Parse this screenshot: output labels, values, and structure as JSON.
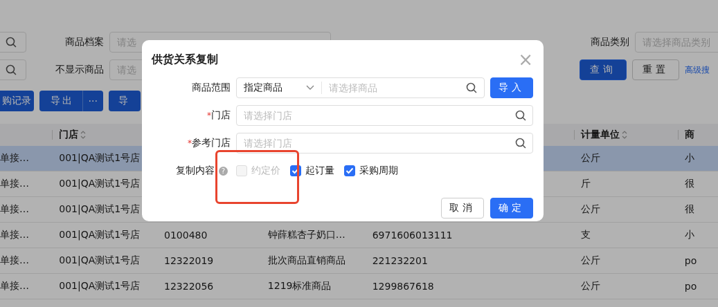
{
  "filters": {
    "row_1": {
      "label": "商品档案",
      "placeholder": "请选",
      "right_label": "商品类别",
      "right_placeholder": "请选择商品类别"
    },
    "row_2": {
      "label": "不显示商品",
      "placeholder": "请选",
      "query_button": "查询",
      "reset_button": "重置",
      "advanced_link": "高级搜"
    }
  },
  "toolbar": {
    "buttons": [
      {
        "label": "购记录",
        "more": false
      },
      {
        "label": "导出",
        "more": true,
        "more_label": "···"
      },
      {
        "label": "导",
        "more": false
      }
    ]
  },
  "table": {
    "columns": [
      {},
      {
        "label": "门店",
        "sortable": true
      },
      {},
      {},
      {},
      {
        "label": "计量单位",
        "sortable": true
      },
      {
        "label": "商",
        "sortable": false
      }
    ],
    "rows": [
      {
        "selected": true,
        "cells": [
          "单接…",
          "001|QA测试1号店",
          null,
          null,
          null,
          "公斤",
          "小"
        ]
      },
      {
        "selected": false,
        "cells": [
          "单接…",
          "001|QA测试1号店",
          null,
          null,
          null,
          "斤",
          "很"
        ]
      },
      {
        "selected": false,
        "cells": [
          "单接…",
          "001|QA测试1号店",
          null,
          null,
          null,
          "公斤",
          "很"
        ]
      },
      {
        "selected": false,
        "cells": [
          "单接…",
          "001|QA测试1号店",
          "0100480",
          "钟薛糕杏子奶口…",
          "6971606013111",
          "支",
          "小"
        ]
      },
      {
        "selected": false,
        "cells": [
          "单接…",
          "001|QA测试1号店",
          "12322019",
          "批次商品直销商品",
          "221232201",
          "公斤",
          "po"
        ]
      },
      {
        "selected": false,
        "cells": [
          "单接…",
          "001|QA测试1号店",
          "12322056",
          "1219标准商品",
          "1299867618",
          "公斤",
          "po"
        ]
      }
    ]
  },
  "dialog": {
    "title": "供货关系复制",
    "close": "×",
    "scope": {
      "label": "商品范围",
      "select_value": "指定商品",
      "placeholder": "请选择商品",
      "import_button": "导入"
    },
    "store": {
      "label": "门店",
      "required_mark": "*",
      "placeholder": "请选择门店"
    },
    "reference_store": {
      "label": "参考门店",
      "required_mark": "*",
      "placeholder": "请选择门店"
    },
    "copy_content": {
      "label": "复制内容",
      "help": "?",
      "options": [
        {
          "label": "约定价",
          "checked": false,
          "disabled": true
        },
        {
          "label": "起订量",
          "checked": true,
          "disabled": false
        },
        {
          "label": "采购周期",
          "checked": true,
          "disabled": false
        }
      ]
    },
    "cancel_button": "取消",
    "ok_button": "确定"
  },
  "annotation": {
    "highlight": true
  }
}
